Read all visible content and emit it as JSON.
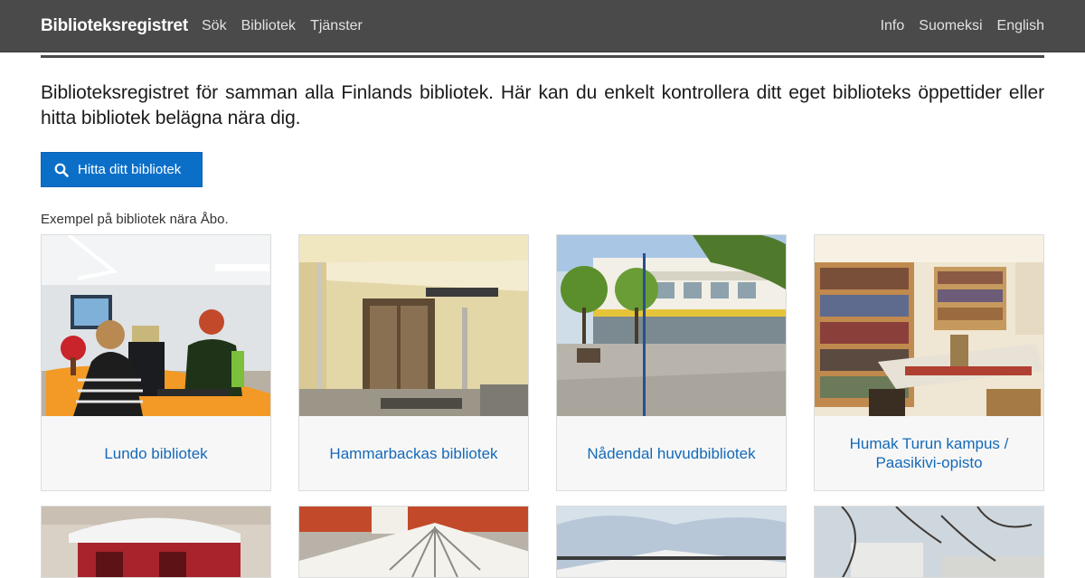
{
  "header": {
    "brand": "Biblioteksregistret",
    "nav_left": [
      "Sök",
      "Bibliotek",
      "Tjänster"
    ],
    "nav_right": [
      "Info",
      "Suomeksi",
      "English"
    ]
  },
  "intro": {
    "text": "Biblioteksregistret för samman alla Finlands bibliotek. Här kan du enkelt kontrollera ditt eget biblioteks öppettider eller hitta bibliotek belägna nära dig."
  },
  "find_button": {
    "label": "Hitta ditt bibliotek",
    "icon": "search-icon"
  },
  "examples": {
    "heading": "Exempel på bibliotek nära Åbo.",
    "libraries": [
      {
        "name": "Lundo bibliotek"
      },
      {
        "name": "Hammarbackas bibliotek"
      },
      {
        "name": "Nådendal huvudbibliotek"
      },
      {
        "name": "Humak Turun kampus / Paasikivi-opisto"
      }
    ]
  },
  "colors": {
    "navbar": "#4a4a4a",
    "primary_button": "#0b6fc8",
    "link": "#1569b8"
  }
}
